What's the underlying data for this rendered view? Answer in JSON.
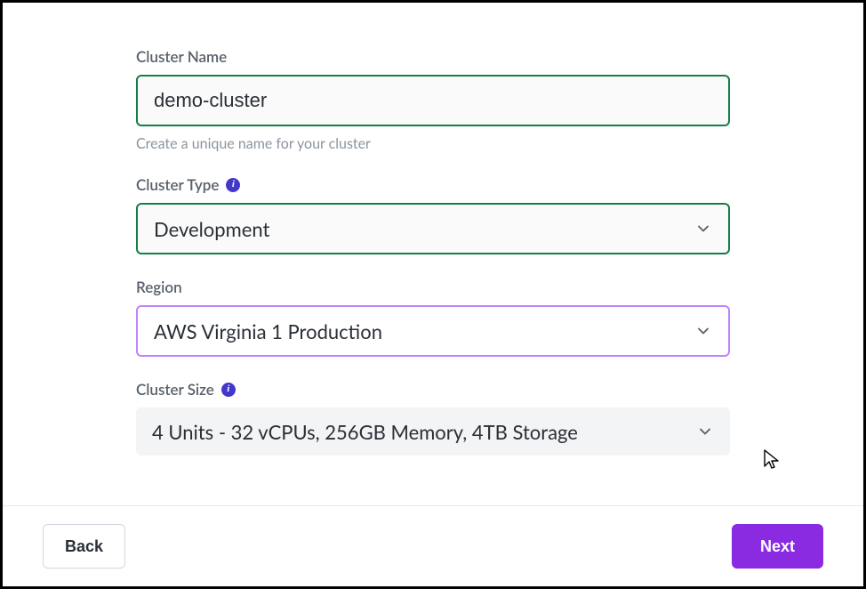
{
  "cluster_name": {
    "label": "Cluster Name",
    "value": "demo-cluster",
    "help": "Create a unique name for your cluster"
  },
  "cluster_type": {
    "label": "Cluster Type",
    "selected": "Development"
  },
  "region": {
    "label": "Region",
    "selected": "AWS Virginia 1 Production"
  },
  "cluster_size": {
    "label": "Cluster Size",
    "selected": "4 Units - 32 vCPUs, 256GB Memory, 4TB Storage"
  },
  "footer": {
    "back_label": "Back",
    "next_label": "Next"
  },
  "colors": {
    "green_border": "#148048",
    "purple_border": "#c084fc",
    "primary_button": "#8a2be2",
    "info_icon": "#4338ca"
  }
}
